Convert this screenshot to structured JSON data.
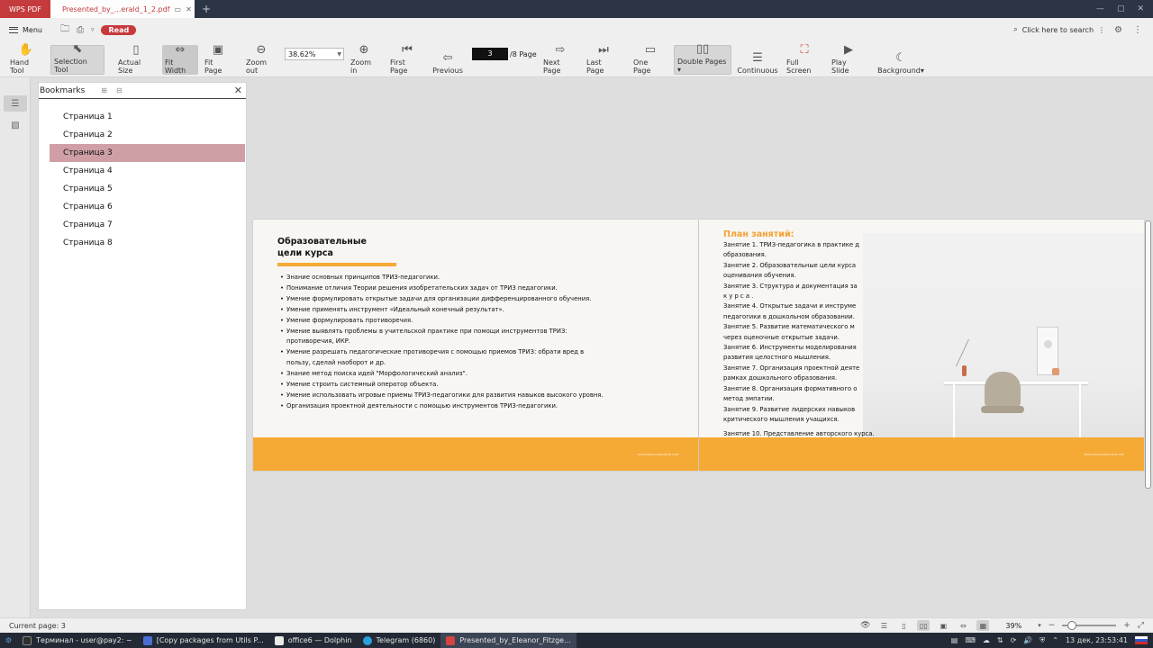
{
  "titlebar": {
    "app_label": "WPS PDF",
    "doc_tab": "Presented_by_...erald_1_2.pdf",
    "add_tab": "+",
    "controls": [
      "—",
      "▢",
      "✕"
    ]
  },
  "menurow": {
    "menu_label": "Menu",
    "read_label": "Read",
    "search_label": "Click here to search"
  },
  "toolbar": {
    "hand": "Hand Tool",
    "selection": "Selection Tool",
    "actual": "Actual Size",
    "fit_width": "Fit Width",
    "fit_page": "Fit Page",
    "zoom_out": "Zoom out",
    "zoom_value": "38.62%",
    "zoom_in": "Zoom in",
    "first": "First Page",
    "previous": "Previous",
    "page_current": "3",
    "page_total": "/8 Page",
    "next": "Next Page",
    "last": "Last Page",
    "one_page": "One Page",
    "double": "Double Pages",
    "continuous": "Continuous",
    "full_screen": "Full Screen",
    "play_slide": "Play Slide",
    "background": "Background"
  },
  "bookmarks": {
    "title": "Bookmarks",
    "items": [
      "Страница 1",
      "Страница 2",
      "Страница 3",
      "Страница 4",
      "Страница 5",
      "Страница 6",
      "Страница 7",
      "Страница 8"
    ],
    "selected_index": 2
  },
  "page_left": {
    "heading_line1": "Образовательные",
    "heading_line2": "цели курса",
    "bullets": [
      "Знание основных принципов ТРИЗ-педагогики.",
      "Понимание отличия Теории решения изобретательских задач от ТРИЗ педагогики.",
      "Умение формулировать открытые задачи для организации дифференцированного обучения.",
      "Умение применять инструмент «Идеальный конечный результат».",
      "Умение формулировать противоречия.",
      "Умение выявлять проблемы в учительской практике при помощи инструментов ТРИЗ: противоречия, ИКР.",
      "Умение разрешать педагогические противоречия с помощью приемов ТРИЗ: обрати вред в пользу, сделай наоборот и др.",
      "Знание метод поиска идей \"Морфологический анализ\".",
      "Умение строить системный оператор объекта.",
      "Умение использовать игровые приемы ТРИЗ-педагогики для развития навыков высокого уровня.",
      "Организация проектной деятельности с помощью инструментов ТРИЗ-педагогики."
    ],
    "footer_text": "WWW.REALLYGREATSITE.COM"
  },
  "page_right": {
    "title": "План занятий:",
    "lines": [
      "Занятие 1. ТРИЗ-педагогика в практике д",
      "образования.",
      "Занятие 2. Образовательные цели курса",
      "оценивания обучения.",
      "Занятие 3. Структура и документация за",
      "к у р с а .",
      "Занятие 4. Открытые задачи и инструме",
      "педагогики в дошкольном образовании.",
      "Занятие 5. Развитие математического м",
      "через оценочные открытые задачи.",
      "Занятие 6. Инструменты моделирования",
      "развития целостного мышления.",
      "Занятие 7. Организация проектной деяте",
      "рамках дошкольного образования.",
      "Занятие 8. Организация формативного о",
      "метод эмпатии.",
      "Занятие 9. Развитие лидерских навыков",
      "критического мышления учащихся.",
      "Занятие 10. Представление авторского курса."
    ],
    "footer_text": "WWW.REALLYGREATSITE.COM"
  },
  "statusbar": {
    "current": "Current page: 3",
    "zoom_pct": "39%",
    "zoom_fraction": 0.39
  },
  "taskbar": {
    "items": [
      {
        "label": "Терминал - user@pay2: ~",
        "color": "#2e2e2e"
      },
      {
        "label": "[Copy packages from Utils P...",
        "color": "#4a6fd0"
      },
      {
        "label": "office6 — Dolphin",
        "color": "#e9e9e9"
      },
      {
        "label": "Telegram (6860)",
        "color": "#2aa0d8"
      },
      {
        "label": "Presented_by_Eleanor_Fitzge...",
        "color": "#d4443f"
      }
    ],
    "clock": "13 дек, 23:53:41"
  },
  "colors": {
    "accent": "#c53a3d",
    "orange": "#f5aa36",
    "selection": "#cf9fa5"
  }
}
